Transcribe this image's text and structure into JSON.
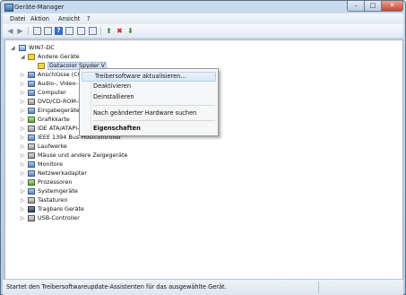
{
  "window": {
    "title": "Geräte-Manager",
    "minimize_glyph": "–",
    "maximize_glyph": "□",
    "close_glyph": "✕"
  },
  "menubar": {
    "items": [
      "Datei",
      "Aktion",
      "Ansicht",
      "?"
    ]
  },
  "toolbar": {
    "icons": [
      "back-arrow-icon",
      "forward-arrow-icon",
      "properties-icon",
      "list-icon",
      "help-icon",
      "view-icon",
      "computer-icon",
      "update-driver-icon",
      "uninstall-icon",
      "scan-hardware-icon"
    ]
  },
  "tree": {
    "root": "WIN7-DC",
    "items": [
      {
        "label": "Andere Geräte",
        "expander": "◢",
        "icon": "warn"
      },
      {
        "label": "Datacolor Spyder V",
        "expander": "",
        "icon": "warn",
        "selected": true
      },
      {
        "label": "Anschlüsse (COM & LPT)",
        "expander": "▷",
        "icon": "normal"
      },
      {
        "label": "Audio-, Video- und Gamecontroller",
        "expander": "▷",
        "icon": "normal"
      },
      {
        "label": "Computer",
        "expander": "▷",
        "icon": "normal"
      },
      {
        "label": "DVD/CD-ROM-Laufwerke",
        "expander": "▷",
        "icon": "gray"
      },
      {
        "label": "Eingabegeräte (Human Interface Devices)",
        "expander": "▷",
        "icon": "normal"
      },
      {
        "label": "Grafikkarte",
        "expander": "▷",
        "icon": "green"
      },
      {
        "label": "IDE ATA/ATAPI-Controller",
        "expander": "▷",
        "icon": "gray"
      },
      {
        "label": "IEEE 1394 Bus-Hostcontroller",
        "expander": "▷",
        "icon": "normal"
      },
      {
        "label": "Laufwerke",
        "expander": "▷",
        "icon": "gray"
      },
      {
        "label": "Mäuse und andere Zeigegeräte",
        "expander": "▷",
        "icon": "gray"
      },
      {
        "label": "Monitore",
        "expander": "▷",
        "icon": "normal"
      },
      {
        "label": "Netzwerkadapter",
        "expander": "▷",
        "icon": "normal"
      },
      {
        "label": "Prozessoren",
        "expander": "▷",
        "icon": "green"
      },
      {
        "label": "Systemgeräte",
        "expander": "▷",
        "icon": "normal"
      },
      {
        "label": "Tastaturen",
        "expander": "▷",
        "icon": "gray"
      },
      {
        "label": "Tragbare Geräte",
        "expander": "▷",
        "icon": "dark"
      },
      {
        "label": "USB-Controller",
        "expander": "▷",
        "icon": "gray"
      }
    ]
  },
  "context_menu": {
    "items": [
      {
        "label": "Treibersoftware aktualisieren...",
        "hover": true
      },
      {
        "label": "Deaktivieren"
      },
      {
        "label": "Deinstallieren"
      },
      {
        "label": "Nach geänderter Hardware suchen"
      },
      {
        "label": "Eigenschaften",
        "bold": true
      }
    ]
  },
  "statusbar": {
    "text": "Startet den Treibersoftwareupdate-Assistenten für das ausgewählte Gerät."
  },
  "colors": {
    "title_gradient_top": "#c9dbed",
    "selection": "#cfe1f7",
    "close_button": "#c8462c"
  }
}
